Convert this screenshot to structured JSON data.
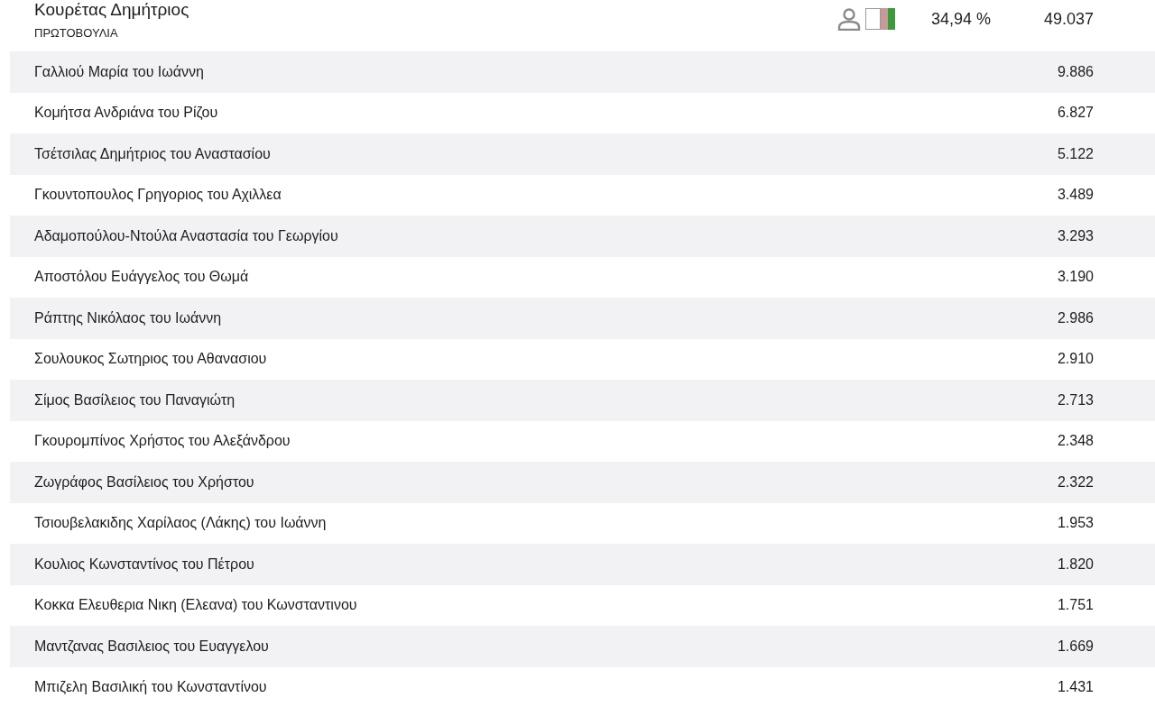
{
  "candidate": {
    "name": "Κουρέτας Δημήτριος",
    "party": "ΠΡΩΤΟΒΟΥΛΙΑ",
    "percent": "34,94 %",
    "votes": "49.037"
  },
  "rows": [
    {
      "name": "Γαλλιού Μαρία του Ιωάννη",
      "votes": "9.886"
    },
    {
      "name": "Κομήτσα Ανδριάνα του Ρίζου",
      "votes": "6.827"
    },
    {
      "name": "Τσέτσιλας Δημήτριος του Αναστασίου",
      "votes": "5.122"
    },
    {
      "name": "Γκουντοπουλος Γρηγοριος του Αχιλλεα",
      "votes": "3.489"
    },
    {
      "name": "Αδαμοπούλου-Ντούλα Αναστασία του Γεωργίου",
      "votes": "3.293"
    },
    {
      "name": "Αποστόλου Ευάγγελος του Θωμά",
      "votes": "3.190"
    },
    {
      "name": "Ράπτης Νικόλαος του Ιωάννη",
      "votes": "2.986"
    },
    {
      "name": "Σουλουκος Σωτηριος του Αθανασιου",
      "votes": "2.910"
    },
    {
      "name": "Σίμος Βασίλειος του Παναγιώτη",
      "votes": "2.713"
    },
    {
      "name": "Γκουρομπίνος Χρήστος του Αλεξάνδρου",
      "votes": "2.348"
    },
    {
      "name": "Ζωγράφος Βασίλειος του Χρήστου",
      "votes": "2.322"
    },
    {
      "name": "Τσιουβελακιδης Χαρίλαος (Λάκης) του Ιωάννη",
      "votes": "1.953"
    },
    {
      "name": "Κουλιος Κωνσταντίνος του Πέτρου",
      "votes": "1.820"
    },
    {
      "name": "Κοκκα Ελευθερια Νικη (Ελεανα) του Κωνσταντινου",
      "votes": "1.751"
    },
    {
      "name": "Μαντζανας Βασιλειος του Ευαγγελου",
      "votes": "1.669"
    },
    {
      "name": "Μπιζελη Βασιλική του Κωνσταντίνου",
      "votes": "1.431"
    }
  ]
}
